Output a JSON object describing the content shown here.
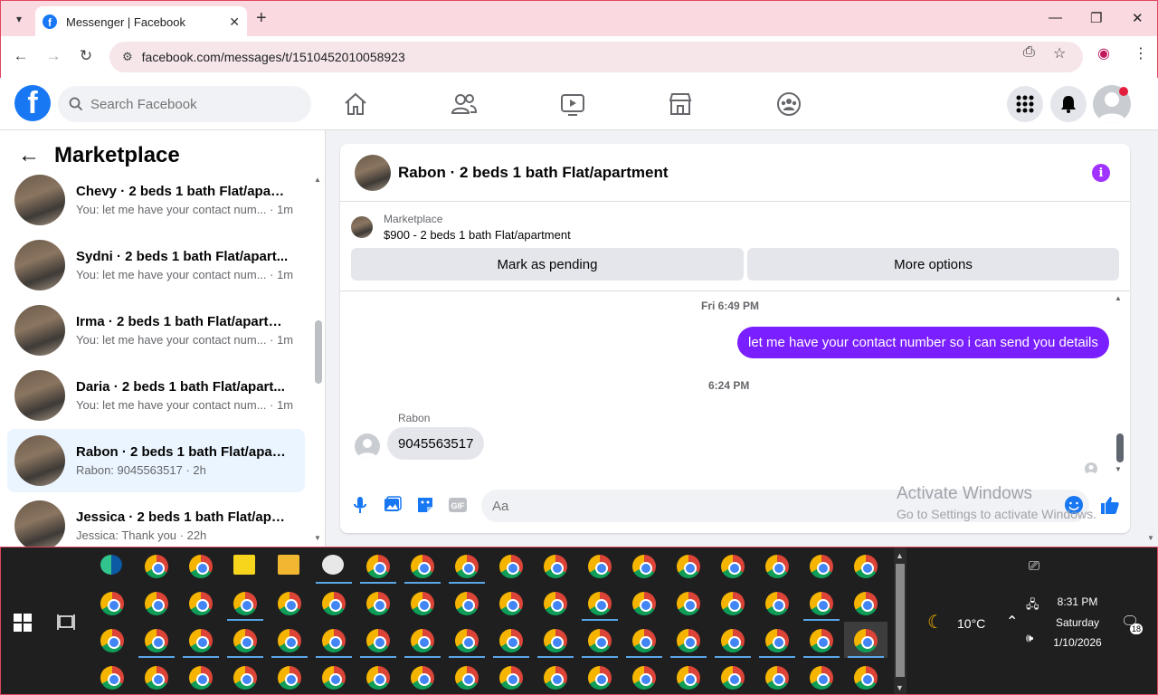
{
  "browser": {
    "tab_title": "Messenger | Facebook",
    "url": "facebook.com/messages/t/1510452010058923"
  },
  "fb": {
    "search_placeholder": "Search Facebook"
  },
  "left": {
    "title": "Marketplace",
    "conversations": [
      {
        "name": "Chevy · 2 beds 1 bath Flat/apart...",
        "sub": "You: let me have your contact num... · 1m"
      },
      {
        "name": "Sydni · 2 beds 1 bath Flat/apart...",
        "sub": "You: let me have your contact num... · 1m"
      },
      {
        "name": "Irma · 2 beds 1 bath Flat/apartm...",
        "sub": "You: let me have your contact num... · 1m"
      },
      {
        "name": "Daria · 2 beds 1 bath Flat/apart...",
        "sub": "You: let me have your contact num... · 1m"
      },
      {
        "name": "Rabon · 2 beds 1 bath Flat/apart...",
        "sub": "Rabon: 9045563517 · 2h"
      },
      {
        "name": "Jessica · 2 beds 1 bath Flat/apart...",
        "sub": "Jessica: Thank you · 22h"
      }
    ]
  },
  "chat": {
    "title": "Rabon · 2 beds 1 bath Flat/apartment",
    "mp_label": "Marketplace",
    "mp_price": "$900 - 2 beds 1 bath Flat/apartment",
    "btn_pending": "Mark as pending",
    "btn_more": "More options",
    "ts1": "Fri 6:49 PM",
    "msg_out": "let me have your contact number so i can send you details",
    "ts2": "6:24 PM",
    "sender": "Rabon",
    "msg_in": "9045563517",
    "input_placeholder": "Aa",
    "gif_label": "GIF"
  },
  "watermark": {
    "line1": "Activate Windows",
    "line2": "Go to Settings to activate Windows."
  },
  "taskbar": {
    "weather": "10°C",
    "time": "8:31 PM",
    "day": "Saturday",
    "date": "1/10/2026",
    "notif_count": "18"
  },
  "colors": {
    "fb_blue": "#1877f2",
    "bubble_out": "#7a1fff",
    "tab_bar": "#fbd9e0"
  }
}
